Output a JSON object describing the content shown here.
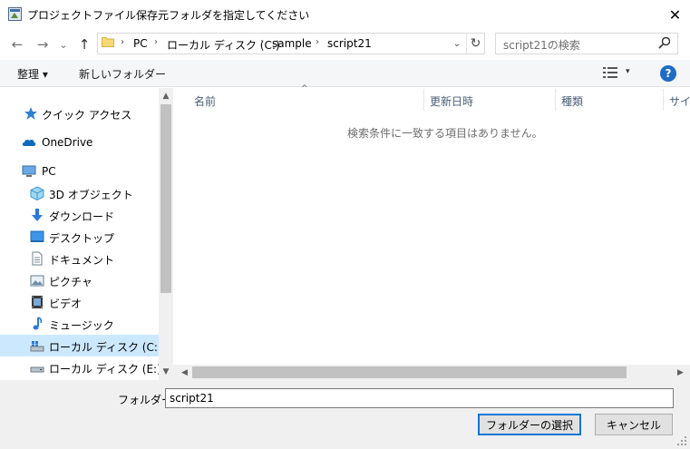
{
  "window": {
    "title": "プロジェクトファイル保存元フォルダを指定してください",
    "close_icon": "close-icon"
  },
  "nav": {
    "back_glyph": "←",
    "forward_glyph": "→",
    "recent_glyph": "⌄",
    "up_glyph": "↑"
  },
  "address": {
    "crumbs": [
      "PC",
      "ローカル ディスク (C:)",
      "sample",
      "script21"
    ],
    "separator": "›",
    "dropdown_glyph": "⌄",
    "refresh_glyph": "↻"
  },
  "search": {
    "placeholder": "script21の検索"
  },
  "toolbar": {
    "organize": "整理 ▾",
    "new_folder": "新しいフォルダー",
    "view_dropdown": "▾",
    "help": "?"
  },
  "sidebar": {
    "items": [
      {
        "label": "クイック アクセス",
        "icon": "star-icon"
      },
      {
        "label": "OneDrive",
        "icon": "cloud-icon"
      },
      {
        "label": "PC",
        "icon": "computer-icon"
      },
      {
        "label": "3D オブジェクト",
        "icon": "cube-icon"
      },
      {
        "label": "ダウンロード",
        "icon": "download-icon"
      },
      {
        "label": "デスクトップ",
        "icon": "desktop-icon"
      },
      {
        "label": "ドキュメント",
        "icon": "document-icon"
      },
      {
        "label": "ピクチャ",
        "icon": "picture-icon"
      },
      {
        "label": "ビデオ",
        "icon": "video-icon"
      },
      {
        "label": "ミュージック",
        "icon": "music-icon"
      },
      {
        "label": "ローカル ディスク (C:)",
        "icon": "drive-icon",
        "selected": true
      },
      {
        "label": "ローカル ディスク (E:)",
        "icon": "drive-icon"
      }
    ]
  },
  "files": {
    "columns": [
      "名前",
      "更新日時",
      "種類",
      "サイズ"
    ],
    "empty_message": "検索条件に一致する項目はありません。"
  },
  "footer": {
    "folder_label": "フォルダー:",
    "folder_value": "script21",
    "select_button": "フォルダーの選択",
    "cancel_button": "キャンセル"
  },
  "colors": {
    "accent": "#0078d7",
    "selected_bg": "#cce8ff",
    "help_bg": "#1e6cc5",
    "folder_yellow": "#f8d775"
  }
}
